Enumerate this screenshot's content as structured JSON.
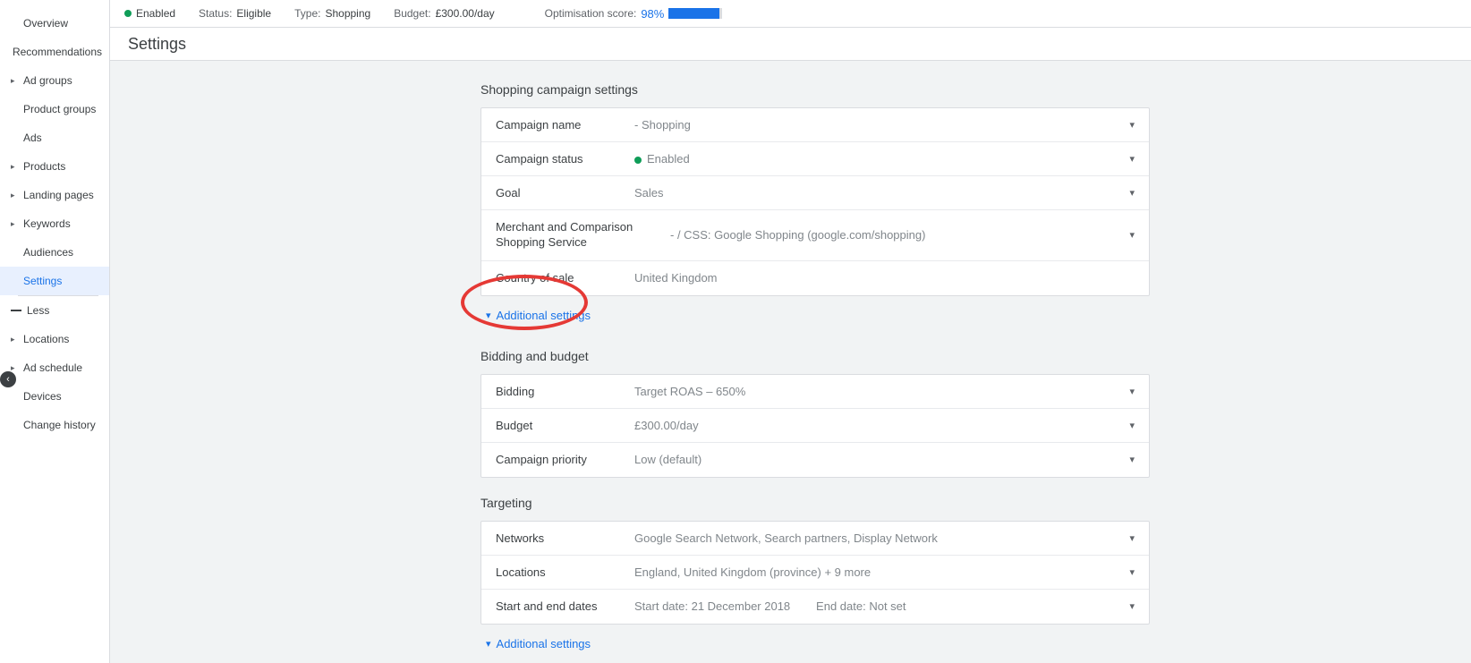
{
  "sidebar": {
    "items": [
      {
        "label": "Overview",
        "expandable": false
      },
      {
        "label": "Recommendations",
        "expandable": false
      },
      {
        "label": "Ad groups",
        "expandable": true
      },
      {
        "label": "Product groups",
        "expandable": false
      },
      {
        "label": "Ads",
        "expandable": false
      },
      {
        "label": "Products",
        "expandable": true
      },
      {
        "label": "Landing pages",
        "expandable": true
      },
      {
        "label": "Keywords",
        "expandable": true
      },
      {
        "label": "Audiences",
        "expandable": false
      },
      {
        "label": "Settings",
        "expandable": false,
        "active": true
      }
    ],
    "less_label": "Less",
    "items2": [
      {
        "label": "Locations",
        "expandable": true
      },
      {
        "label": "Ad schedule",
        "expandable": true
      },
      {
        "label": "Devices",
        "expandable": false
      },
      {
        "label": "Change history",
        "expandable": false
      }
    ]
  },
  "statusbar": {
    "enabled_label": "Enabled",
    "status_label": "Status:",
    "status_value": "Eligible",
    "type_label": "Type:",
    "type_value": "Shopping",
    "budget_label": "Budget:",
    "budget_value": "£300.00/day",
    "opt_label": "Optimisation score:",
    "opt_value": "98%"
  },
  "page_title": "Settings",
  "sections": {
    "shopping": {
      "title": "Shopping campaign settings",
      "rows": {
        "campaign_name": {
          "label": "Campaign name",
          "value": "- Shopping"
        },
        "campaign_status": {
          "label": "Campaign status",
          "value": "Enabled"
        },
        "goal": {
          "label": "Goal",
          "value": "Sales"
        },
        "merchant": {
          "label": "Merchant and Comparison Shopping Service",
          "value": "- / CSS: Google Shopping (google.com/shopping)"
        },
        "country": {
          "label": "Country of sale",
          "value": "United Kingdom"
        }
      },
      "additional": "Additional settings"
    },
    "bidding": {
      "title": "Bidding and budget",
      "rows": {
        "bidding": {
          "label": "Bidding",
          "value": "Target ROAS – 650%"
        },
        "budget": {
          "label": "Budget",
          "value": "£300.00/day"
        },
        "priority": {
          "label": "Campaign priority",
          "value": "Low (default)"
        }
      }
    },
    "targeting": {
      "title": "Targeting",
      "rows": {
        "networks": {
          "label": "Networks",
          "value": "Google Search Network, Search partners, Display Network"
        },
        "locations": {
          "label": "Locations",
          "value": "England, United Kingdom (province) + 9 more"
        },
        "dates": {
          "label": "Start and end dates",
          "value": "Start date: 21 December 2018        End date: Not set"
        }
      },
      "additional": "Additional settings"
    }
  }
}
